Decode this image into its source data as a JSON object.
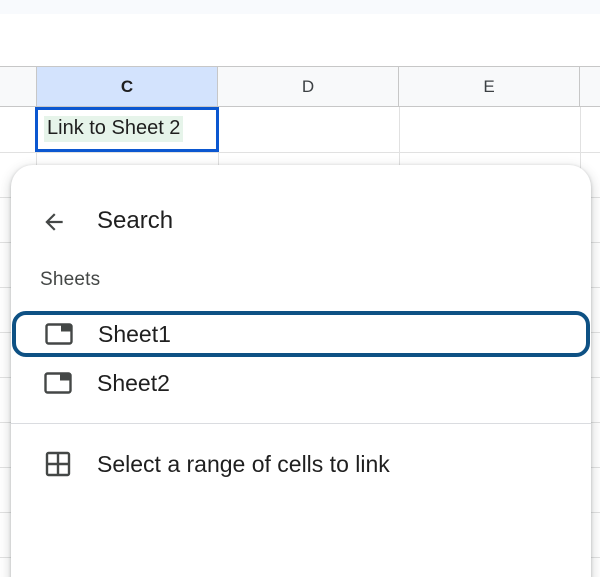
{
  "grid": {
    "columns": [
      {
        "label": "C",
        "selected": true
      },
      {
        "label": "D",
        "selected": false
      },
      {
        "label": "E",
        "selected": false
      }
    ],
    "active_cell_text": "Link to Sheet 2"
  },
  "popup": {
    "back_icon": "arrow-back-icon",
    "search_label": "Search",
    "section_label": "Sheets",
    "sheets": [
      {
        "label": "Sheet1",
        "icon": "sheet-tab-icon",
        "focused": true
      },
      {
        "label": "Sheet2",
        "icon": "sheet-tab-icon",
        "focused": false
      }
    ],
    "range_option": {
      "label": "Select a range of cells to link",
      "icon": "grid-icon"
    }
  },
  "colors": {
    "selected_header_bg": "#d3e3fd",
    "active_cell_border": "#0b57d0",
    "link_highlight": "#e6f4ea",
    "focus_ring": "#0e5184"
  }
}
